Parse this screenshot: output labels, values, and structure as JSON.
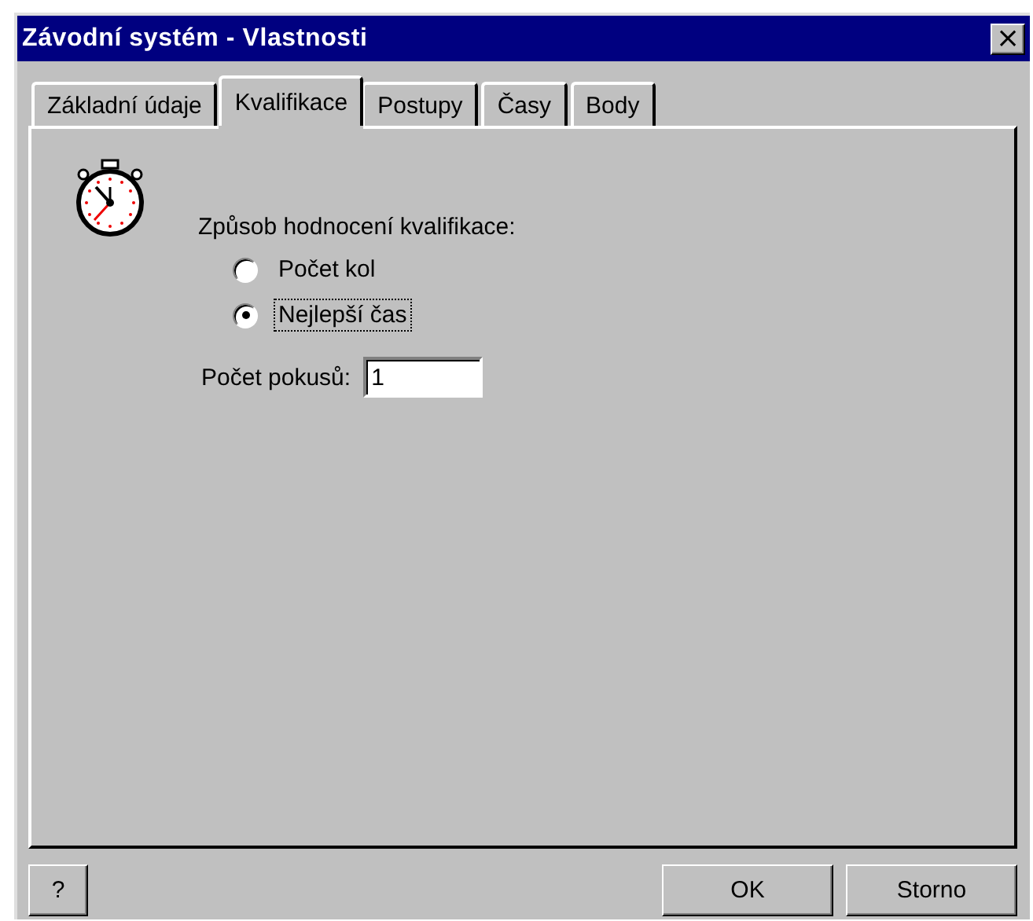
{
  "window": {
    "title": "Závodní systém - Vlastnosti",
    "close": "×"
  },
  "tabs": [
    {
      "label": "Základní údaje",
      "selected": false
    },
    {
      "label": "Kvalifikace",
      "selected": true
    },
    {
      "label": "Postupy",
      "selected": false
    },
    {
      "label": "Časy",
      "selected": false
    },
    {
      "label": "Body",
      "selected": false
    }
  ],
  "qualification": {
    "label": "Způsob hodnocení kvalifikace:",
    "options": [
      {
        "label": "Počet kol",
        "selected": false,
        "focused": false
      },
      {
        "label": "Nejlepší čas",
        "selected": true,
        "focused": true
      }
    ]
  },
  "attempts": {
    "label": "Počet pokusů:",
    "value": "1"
  },
  "buttons": {
    "help": "?",
    "ok": "OK",
    "cancel": "Storno"
  }
}
